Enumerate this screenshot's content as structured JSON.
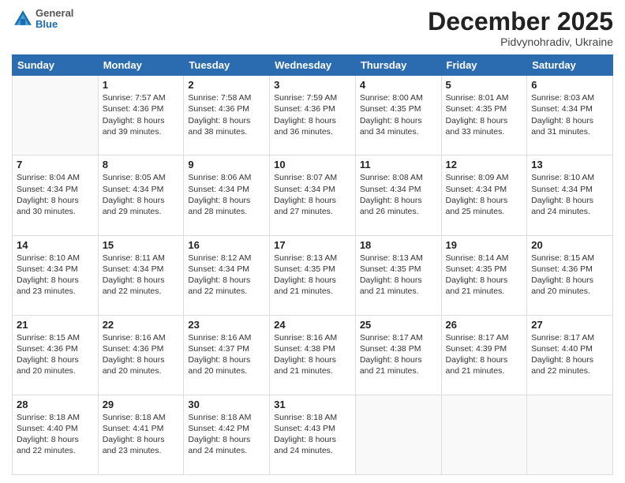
{
  "header": {
    "logo": {
      "general": "General",
      "blue": "Blue"
    },
    "month": "December 2025",
    "location": "Pidvynohradiv, Ukraine"
  },
  "weekdays": [
    "Sunday",
    "Monday",
    "Tuesday",
    "Wednesday",
    "Thursday",
    "Friday",
    "Saturday"
  ],
  "weeks": [
    [
      {
        "day": "",
        "lines": []
      },
      {
        "day": "1",
        "lines": [
          "Sunrise: 7:57 AM",
          "Sunset: 4:36 PM",
          "Daylight: 8 hours",
          "and 39 minutes."
        ]
      },
      {
        "day": "2",
        "lines": [
          "Sunrise: 7:58 AM",
          "Sunset: 4:36 PM",
          "Daylight: 8 hours",
          "and 38 minutes."
        ]
      },
      {
        "day": "3",
        "lines": [
          "Sunrise: 7:59 AM",
          "Sunset: 4:36 PM",
          "Daylight: 8 hours",
          "and 36 minutes."
        ]
      },
      {
        "day": "4",
        "lines": [
          "Sunrise: 8:00 AM",
          "Sunset: 4:35 PM",
          "Daylight: 8 hours",
          "and 34 minutes."
        ]
      },
      {
        "day": "5",
        "lines": [
          "Sunrise: 8:01 AM",
          "Sunset: 4:35 PM",
          "Daylight: 8 hours",
          "and 33 minutes."
        ]
      },
      {
        "day": "6",
        "lines": [
          "Sunrise: 8:03 AM",
          "Sunset: 4:34 PM",
          "Daylight: 8 hours",
          "and 31 minutes."
        ]
      }
    ],
    [
      {
        "day": "7",
        "lines": [
          "Sunrise: 8:04 AM",
          "Sunset: 4:34 PM",
          "Daylight: 8 hours",
          "and 30 minutes."
        ]
      },
      {
        "day": "8",
        "lines": [
          "Sunrise: 8:05 AM",
          "Sunset: 4:34 PM",
          "Daylight: 8 hours",
          "and 29 minutes."
        ]
      },
      {
        "day": "9",
        "lines": [
          "Sunrise: 8:06 AM",
          "Sunset: 4:34 PM",
          "Daylight: 8 hours",
          "and 28 minutes."
        ]
      },
      {
        "day": "10",
        "lines": [
          "Sunrise: 8:07 AM",
          "Sunset: 4:34 PM",
          "Daylight: 8 hours",
          "and 27 minutes."
        ]
      },
      {
        "day": "11",
        "lines": [
          "Sunrise: 8:08 AM",
          "Sunset: 4:34 PM",
          "Daylight: 8 hours",
          "and 26 minutes."
        ]
      },
      {
        "day": "12",
        "lines": [
          "Sunrise: 8:09 AM",
          "Sunset: 4:34 PM",
          "Daylight: 8 hours",
          "and 25 minutes."
        ]
      },
      {
        "day": "13",
        "lines": [
          "Sunrise: 8:10 AM",
          "Sunset: 4:34 PM",
          "Daylight: 8 hours",
          "and 24 minutes."
        ]
      }
    ],
    [
      {
        "day": "14",
        "lines": [
          "Sunrise: 8:10 AM",
          "Sunset: 4:34 PM",
          "Daylight: 8 hours",
          "and 23 minutes."
        ]
      },
      {
        "day": "15",
        "lines": [
          "Sunrise: 8:11 AM",
          "Sunset: 4:34 PM",
          "Daylight: 8 hours",
          "and 22 minutes."
        ]
      },
      {
        "day": "16",
        "lines": [
          "Sunrise: 8:12 AM",
          "Sunset: 4:34 PM",
          "Daylight: 8 hours",
          "and 22 minutes."
        ]
      },
      {
        "day": "17",
        "lines": [
          "Sunrise: 8:13 AM",
          "Sunset: 4:35 PM",
          "Daylight: 8 hours",
          "and 21 minutes."
        ]
      },
      {
        "day": "18",
        "lines": [
          "Sunrise: 8:13 AM",
          "Sunset: 4:35 PM",
          "Daylight: 8 hours",
          "and 21 minutes."
        ]
      },
      {
        "day": "19",
        "lines": [
          "Sunrise: 8:14 AM",
          "Sunset: 4:35 PM",
          "Daylight: 8 hours",
          "and 21 minutes."
        ]
      },
      {
        "day": "20",
        "lines": [
          "Sunrise: 8:15 AM",
          "Sunset: 4:36 PM",
          "Daylight: 8 hours",
          "and 20 minutes."
        ]
      }
    ],
    [
      {
        "day": "21",
        "lines": [
          "Sunrise: 8:15 AM",
          "Sunset: 4:36 PM",
          "Daylight: 8 hours",
          "and 20 minutes."
        ]
      },
      {
        "day": "22",
        "lines": [
          "Sunrise: 8:16 AM",
          "Sunset: 4:36 PM",
          "Daylight: 8 hours",
          "and 20 minutes."
        ]
      },
      {
        "day": "23",
        "lines": [
          "Sunrise: 8:16 AM",
          "Sunset: 4:37 PM",
          "Daylight: 8 hours",
          "and 20 minutes."
        ]
      },
      {
        "day": "24",
        "lines": [
          "Sunrise: 8:16 AM",
          "Sunset: 4:38 PM",
          "Daylight: 8 hours",
          "and 21 minutes."
        ]
      },
      {
        "day": "25",
        "lines": [
          "Sunrise: 8:17 AM",
          "Sunset: 4:38 PM",
          "Daylight: 8 hours",
          "and 21 minutes."
        ]
      },
      {
        "day": "26",
        "lines": [
          "Sunrise: 8:17 AM",
          "Sunset: 4:39 PM",
          "Daylight: 8 hours",
          "and 21 minutes."
        ]
      },
      {
        "day": "27",
        "lines": [
          "Sunrise: 8:17 AM",
          "Sunset: 4:40 PM",
          "Daylight: 8 hours",
          "and 22 minutes."
        ]
      }
    ],
    [
      {
        "day": "28",
        "lines": [
          "Sunrise: 8:18 AM",
          "Sunset: 4:40 PM",
          "Daylight: 8 hours",
          "and 22 minutes."
        ]
      },
      {
        "day": "29",
        "lines": [
          "Sunrise: 8:18 AM",
          "Sunset: 4:41 PM",
          "Daylight: 8 hours",
          "and 23 minutes."
        ]
      },
      {
        "day": "30",
        "lines": [
          "Sunrise: 8:18 AM",
          "Sunset: 4:42 PM",
          "Daylight: 8 hours",
          "and 24 minutes."
        ]
      },
      {
        "day": "31",
        "lines": [
          "Sunrise: 8:18 AM",
          "Sunset: 4:43 PM",
          "Daylight: 8 hours",
          "and 24 minutes."
        ]
      },
      {
        "day": "",
        "lines": []
      },
      {
        "day": "",
        "lines": []
      },
      {
        "day": "",
        "lines": []
      }
    ]
  ]
}
